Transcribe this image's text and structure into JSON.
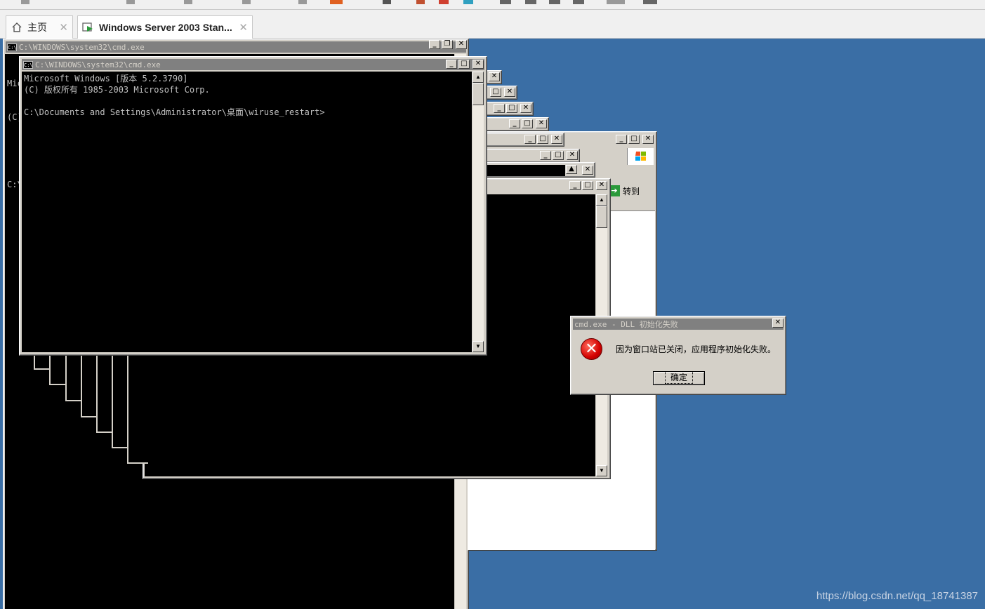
{
  "host": {
    "tabs": [
      {
        "label": "主页",
        "icon": "home-icon"
      },
      {
        "label": "Windows Server 2003 Stan...",
        "icon": "vm-icon"
      }
    ],
    "close_glyph": "✕"
  },
  "windows": {
    "back_cmd": {
      "title": "C:\\WINDOWS\\system32\\cmd.exe",
      "lines": [
        "Mic",
        "(C)",
        "",
        "C:\\"
      ]
    },
    "front_cmd": {
      "title": "C:\\WINDOWS\\system32\\cmd.exe",
      "console": "Microsoft Windows [版本 5.2.3790]\n(C) 版权所有 1985-2003 Microsoft Corp.\n\nC:\\Documents and Settings\\Administrator\\桌面\\wiruse_restart>"
    },
    "ie_goto_label": "转到"
  },
  "dialog": {
    "title": "cmd.exe - DLL 初始化失败",
    "message": "因为窗口站已关闭，应用程序初始化失败。",
    "ok_label": "确定",
    "icon": "error-icon"
  },
  "watermark": "https://blog.csdn.net/qq_18741387",
  "colors": {
    "desktop": "#3a6ea5",
    "title_active": "#0a246a",
    "title_inactive": "#808080",
    "window_face": "#d4d0c8"
  }
}
